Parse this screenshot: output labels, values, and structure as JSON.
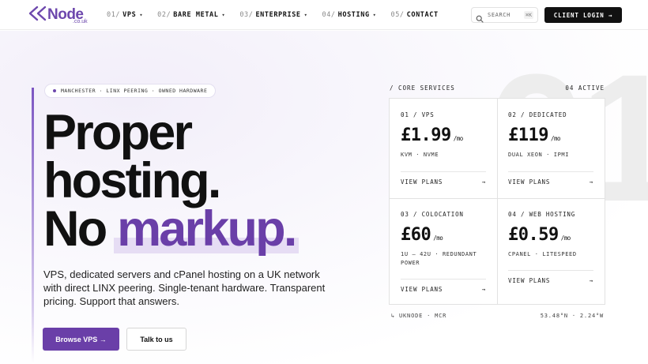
{
  "brand": {
    "name": "Node",
    "sub": ".co.uk",
    "accent": "#6a3fa8"
  },
  "nav": {
    "items": [
      {
        "num": "01/",
        "label": "VPS",
        "dropdown": true
      },
      {
        "num": "02/",
        "label": "BARE METAL",
        "dropdown": true
      },
      {
        "num": "03/",
        "label": "ENTERPRISE",
        "dropdown": true
      },
      {
        "num": "04/",
        "label": "HOSTING",
        "dropdown": true
      },
      {
        "num": "05/",
        "label": "CONTACT",
        "dropdown": false
      }
    ],
    "search": {
      "label": "SEARCH",
      "shortcut": "⌘K"
    },
    "login_label": "CLIENT LOGIN →"
  },
  "hero": {
    "badge": "MANCHESTER · LINX PEERING · OWNED HARDWARE",
    "headline": {
      "line1": "Proper",
      "line2": "hosting.",
      "line3_plain": "No ",
      "line3_accent": "markup."
    },
    "subtext": "VPS, dedicated servers and cPanel hosting on a UK network with direct LINX peering. Single-tenant hardware. Transparent pricing. Support that answers.",
    "primary_button": "Browse VPS →",
    "secondary_button": "Talk to us"
  },
  "services": {
    "heading": "/ CORE SERVICES",
    "count_label": "04 ACTIVE",
    "bg_number": "01",
    "cards": [
      {
        "label": "01 / VPS",
        "price": "£1.99",
        "unit": "/mo",
        "spec": "KVM · NVME",
        "link": "VIEW PLANS",
        "arrow": "→"
      },
      {
        "label": "02 / DEDICATED",
        "price": "£119",
        "unit": "/mo",
        "spec": "DUAL XEON · IPMI",
        "link": "VIEW PLANS",
        "arrow": "→"
      },
      {
        "label": "03 / COLOCATION",
        "price": "£60",
        "unit": "/mo",
        "spec": "1U – 42U · REDUNDANT POWER",
        "link": "VIEW PLANS",
        "arrow": "→"
      },
      {
        "label": "04 / WEB HOSTING",
        "price": "£0.59",
        "unit": "/mo",
        "spec": "CPANEL · LITESPEED",
        "link": "VIEW PLANS",
        "arrow": "→"
      }
    ],
    "footer_left": "↳ UKNODE · MCR",
    "footer_right": "53.48°N · 2.24°W"
  }
}
